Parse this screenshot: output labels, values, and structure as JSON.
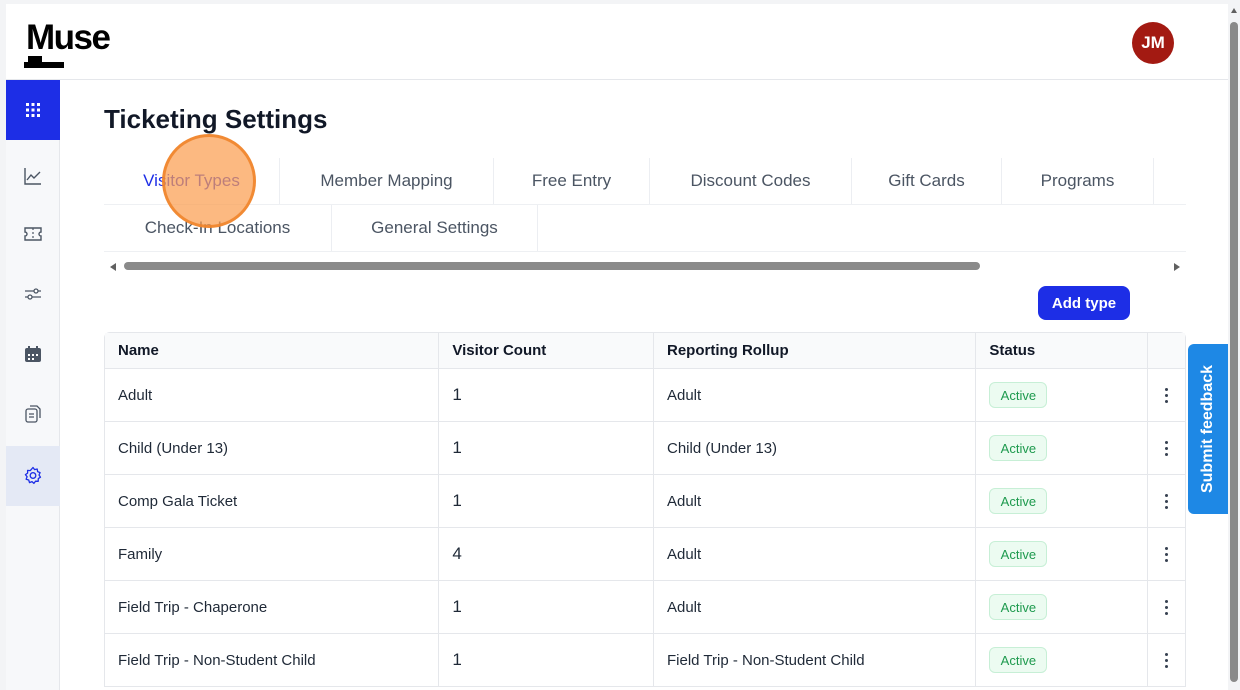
{
  "app": {
    "logo_text": "Muse",
    "avatar_initials": "JM"
  },
  "sidebar": {
    "items": [
      {
        "icon": "grid-icon",
        "state": "active"
      },
      {
        "icon": "chart-line-icon"
      },
      {
        "icon": "ticket-icon"
      },
      {
        "icon": "sliders-icon"
      },
      {
        "icon": "calendar-icon"
      },
      {
        "icon": "documents-icon"
      },
      {
        "icon": "gear-icon",
        "state": "current"
      }
    ]
  },
  "page": {
    "title": "Ticketing Settings"
  },
  "tabs": [
    {
      "label": "Visitor Types",
      "selected": true
    },
    {
      "label": "Member Mapping"
    },
    {
      "label": "Free Entry"
    },
    {
      "label": "Discount Codes"
    },
    {
      "label": "Gift Cards"
    },
    {
      "label": "Programs"
    },
    {
      "label": "Check-In Locations"
    },
    {
      "label": "General Settings"
    }
  ],
  "actions": {
    "add_type_label": "Add type"
  },
  "table": {
    "columns": [
      "Name",
      "Visitor Count",
      "Reporting Rollup",
      "Status"
    ],
    "rows": [
      {
        "name": "Adult",
        "count": "1",
        "rollup": "Adult",
        "status": "Active"
      },
      {
        "name": "Child (Under 13)",
        "count": "1",
        "rollup": "Child (Under 13)",
        "status": "Active"
      },
      {
        "name": "Comp Gala Ticket",
        "count": "1",
        "rollup": "Adult",
        "status": "Active"
      },
      {
        "name": "Family",
        "count": "4",
        "rollup": "Adult",
        "status": "Active"
      },
      {
        "name": "Field Trip - Chaperone",
        "count": "1",
        "rollup": "Adult",
        "status": "Active"
      },
      {
        "name": "Field Trip - Non-Student Child",
        "count": "1",
        "rollup": "Field Trip - Non-Student Child",
        "status": "Active"
      }
    ]
  },
  "feedback": {
    "label": "Submit feedback"
  },
  "colors": {
    "accent": "#1d2ee6",
    "avatar": "#a31a12",
    "active_badge": "#1e9a4e",
    "feedback": "#1e88e5",
    "highlight": "#fb9e50"
  }
}
